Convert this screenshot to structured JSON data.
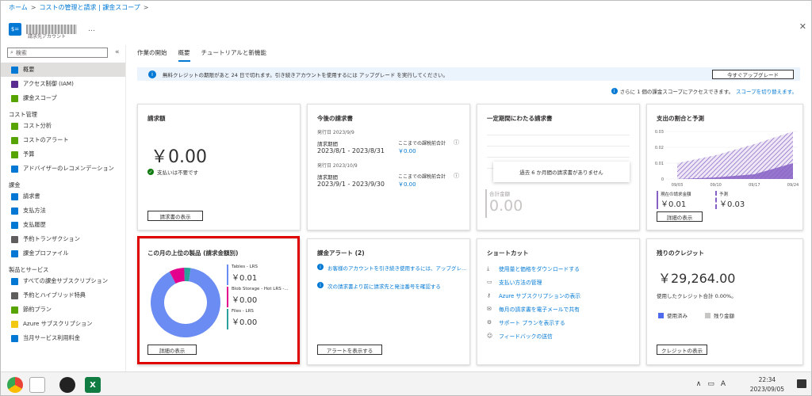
{
  "breadcrumb": [
    "ホーム",
    "コストの管理と請求 | 課金スコープ"
  ],
  "resource": {
    "subtitle": "請求先アカウント",
    "more": "…",
    "icon_label": "$="
  },
  "sidebar": {
    "search_placeholder": "検索",
    "collapse": "«",
    "items": [
      {
        "type": "item",
        "label": "概要",
        "active": true,
        "icon_color": "#0078d4"
      },
      {
        "type": "item",
        "label": "アクセス制御 (IAM)",
        "icon_color": "#5c2d91"
      },
      {
        "type": "item",
        "label": "課金スコープ",
        "icon_color": "#57a300"
      },
      {
        "type": "head",
        "label": "コスト管理"
      },
      {
        "type": "item",
        "label": "コスト分析",
        "icon_color": "#57a300"
      },
      {
        "type": "item",
        "label": "コストのアラート",
        "icon_color": "#57a300"
      },
      {
        "type": "item",
        "label": "予算",
        "icon_color": "#57a300"
      },
      {
        "type": "item",
        "label": "アドバイザーのレコメンデーション",
        "icon_color": "#0078d4"
      },
      {
        "type": "head",
        "label": "課金"
      },
      {
        "type": "item",
        "label": "請求書",
        "icon_color": "#0078d4"
      },
      {
        "type": "item",
        "label": "支払方法",
        "icon_color": "#0078d4"
      },
      {
        "type": "item",
        "label": "支払履歴",
        "icon_color": "#0078d4"
      },
      {
        "type": "item",
        "label": "予約トランザクション",
        "icon_color": "#605e5c"
      },
      {
        "type": "item",
        "label": "課金プロファイル",
        "icon_color": "#0078d4"
      },
      {
        "type": "head",
        "label": "製品とサービス"
      },
      {
        "type": "item",
        "label": "すべての課金サブスクリプション",
        "icon_color": "#0078d4"
      },
      {
        "type": "item",
        "label": "予約とハイブリッド特典",
        "icon_color": "#605e5c"
      },
      {
        "type": "item",
        "label": "節約プラン",
        "icon_color": "#57a300"
      },
      {
        "type": "item",
        "label": "Azure サブスクリプション",
        "icon_color": "#f2c811"
      },
      {
        "type": "item",
        "label": "当月サービス利用料金",
        "icon_color": "#0078d4"
      }
    ]
  },
  "tabs": [
    "作業の開始",
    "概要",
    "チュートリアルと新機能"
  ],
  "banner": {
    "text": "無料クレジットの期限があと 24 日で切れます。引き続きアカウントを使用するには アップグレード を実行してください。",
    "button": "今すぐアップグレード"
  },
  "scope_line": {
    "text": "さらに 1 個の課金スコープにアクセスできます。",
    "link": "スコープを切り替えます。"
  },
  "cards": {
    "invoice_amount": {
      "title": "請求額",
      "amount": "￥0.00",
      "status": "支払いは不要です",
      "button": "請求書の表示"
    },
    "upcoming": {
      "title": "今後の請求書",
      "invoices": [
        {
          "issue": "発行日 2023/9/9",
          "period_label": "請求期間",
          "period": "2023/8/1 - 2023/8/31",
          "total_label": "ここまでの課税前合計",
          "total": "￥0.00"
        },
        {
          "issue": "発行日 2023/10/9",
          "period_label": "請求期間",
          "period": "2023/9/1 - 2023/9/30",
          "total_label": "ここまでの課税前合計",
          "total": "￥0.00"
        }
      ]
    },
    "period_invoices": {
      "title": "一定期間にわたる請求書",
      "empty": "過去 6 か月間の請求書がありません",
      "total_label": "合計金額",
      "total": "0.00"
    },
    "spending": {
      "title": "支出の割合と予測",
      "current_label": "現在の請求金額",
      "current": "￥0.01",
      "forecast_label": "予測",
      "forecast": "￥0.03",
      "button": "詳細の表示",
      "chart_data": {
        "type": "area",
        "x": [
          "09/03",
          "09/10",
          "09/17",
          "09/24"
        ],
        "y_ticks": [
          "0.03",
          "0.02",
          "0.01",
          "0"
        ],
        "ylim": [
          0,
          0.03
        ],
        "series": [
          {
            "name": "現在の請求金額",
            "values": [
              0,
              0.001,
              0.003,
              0.01
            ]
          },
          {
            "name": "予測",
            "values": [
              0.01,
              0.015,
              0.022,
              0.03
            ]
          }
        ]
      }
    },
    "top_products": {
      "title": "この月の上位の製品 (請求金額別)",
      "button": "詳細の表示",
      "chart_data": {
        "type": "pie",
        "categories": [
          "Tables - LRS",
          "Blob Storage - Hot LRS -...",
          "Files - LRS"
        ],
        "values": [
          0.01,
          0.0,
          0.0
        ],
        "labels": [
          "￥0.01",
          "￥0.00",
          "￥0.00"
        ],
        "colors": [
          "#6b8cf2",
          "#e3008c",
          "#2aa19b"
        ],
        "shares": [
          0.9,
          0.07,
          0.03
        ]
      }
    },
    "billing_alerts": {
      "title": "課金アラート (2)",
      "items": [
        "お客様のアカウントを引き続き使用するには、アップグレ...",
        "次の請求書より前に請求先と発注番号を確認する"
      ],
      "button": "アラートを表示する"
    },
    "shortcuts": {
      "title": "ショートカット",
      "items": [
        {
          "label": "使用量と価格をダウンロードする",
          "icon": "download-icon"
        },
        {
          "label": "支払い方法の管理",
          "icon": "card-icon"
        },
        {
          "label": "Azure サブスクリプションの表示",
          "icon": "key-icon"
        },
        {
          "label": "毎月の請求書を電子メールで共有",
          "icon": "mail-icon"
        },
        {
          "label": "サポート プランを表示する",
          "icon": "gear-icon"
        },
        {
          "label": "フィードバックの送信",
          "icon": "feedback-icon"
        }
      ]
    },
    "credits": {
      "title": "残りのクレジット",
      "amount": "￥29,264.00",
      "used_text": "使用したクレジット合計 0.00%。",
      "legend_used": "使用済み",
      "legend_remaining": "残り金額",
      "button": "クレジットの表示"
    }
  },
  "taskbar": {
    "time": "22:34",
    "date": "2023/09/05",
    "ime": "A",
    "tray_up": "∧"
  },
  "colors": {
    "accent": "#0078d4",
    "highlight": "#e00000",
    "forecast": "#8661c5"
  }
}
